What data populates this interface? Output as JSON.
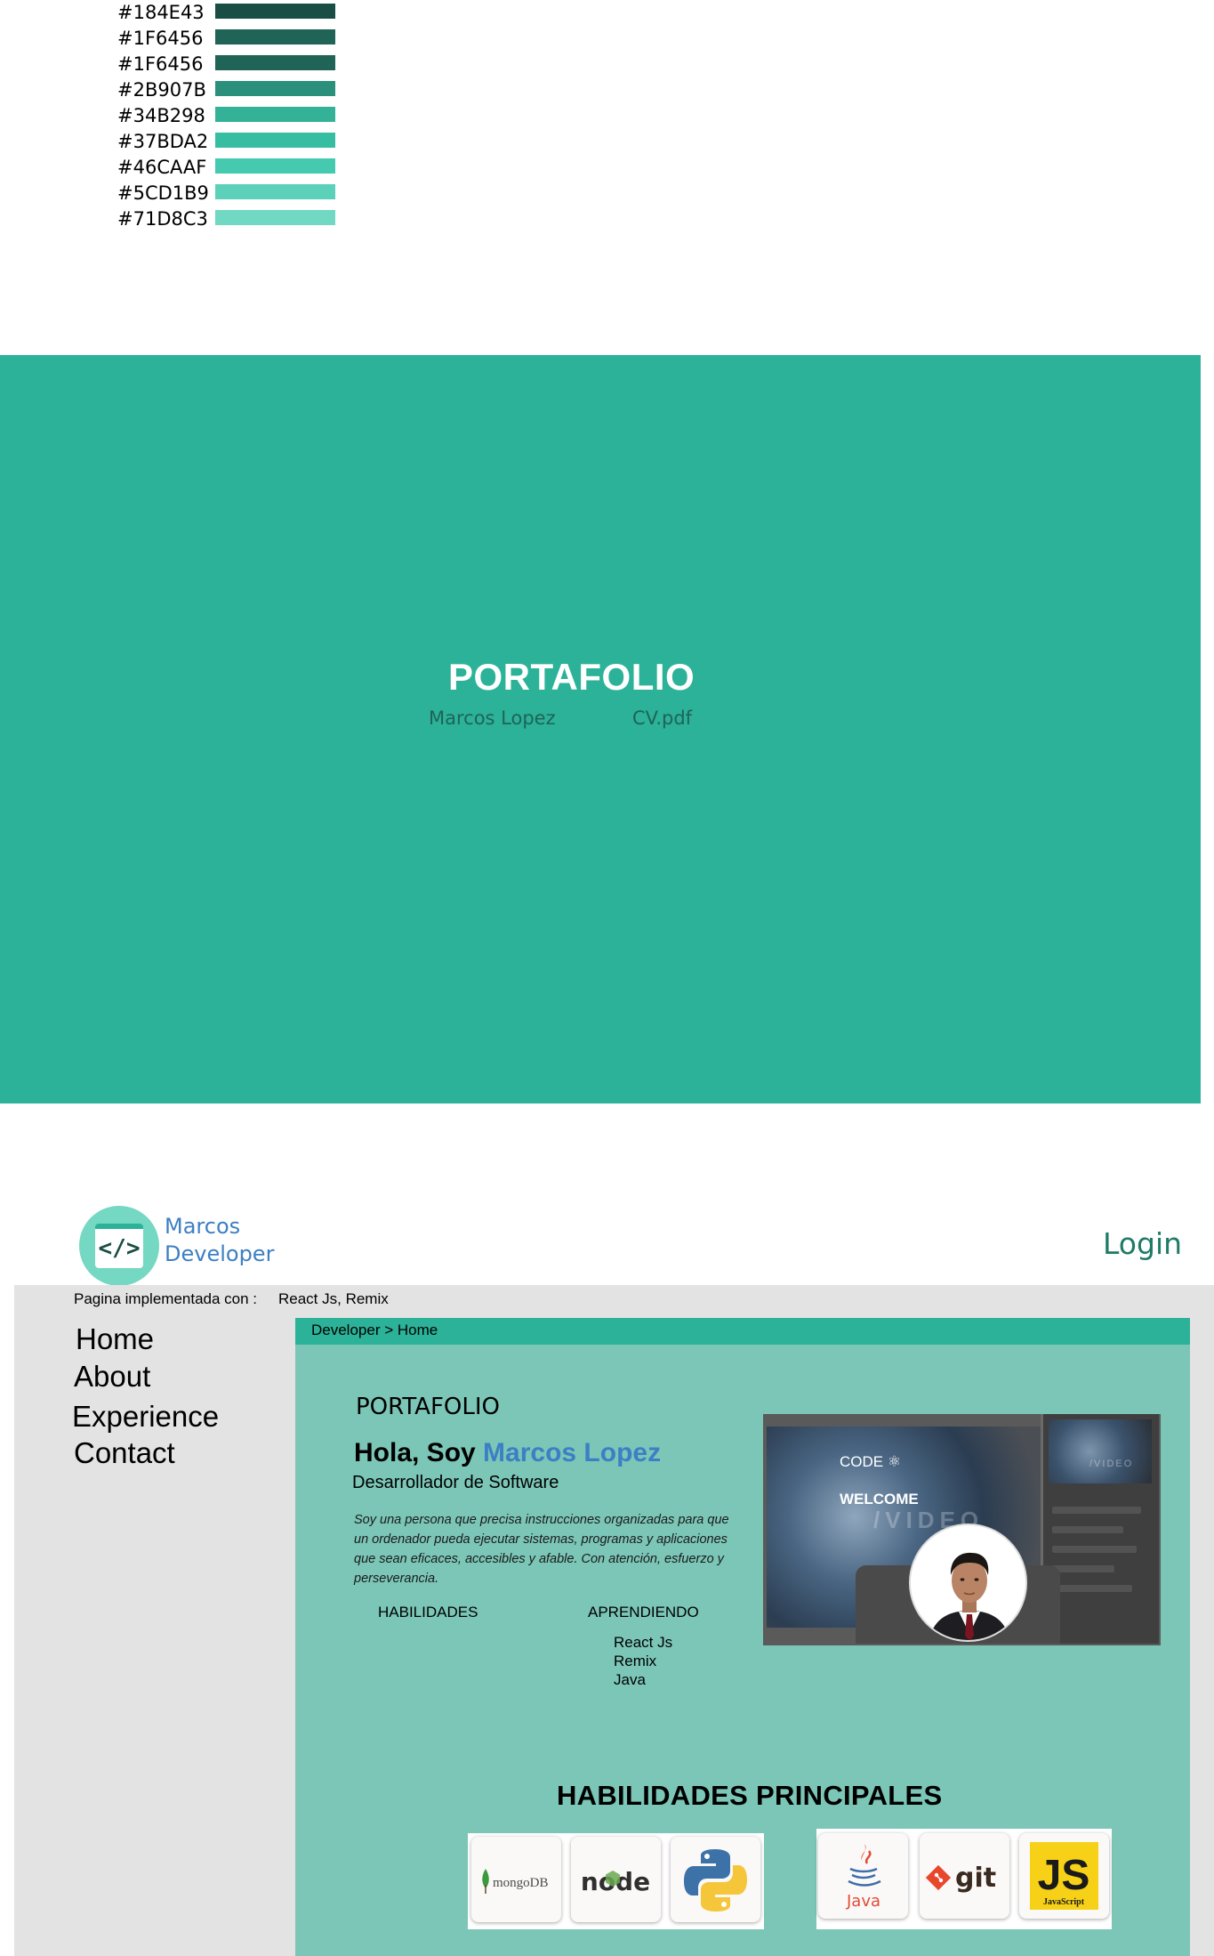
{
  "palette": [
    {
      "label": "#184E43",
      "color": "#184E43"
    },
    {
      "label": "#1F6456",
      "color": "#1F6456"
    },
    {
      "label": "#1F6456",
      "color": "#1F6456"
    },
    {
      "label": "#2B907B",
      "color": "#2B907B"
    },
    {
      "label": "#34B298",
      "color": "#34B298"
    },
    {
      "label": "#37BDA2",
      "color": "#37BDA2"
    },
    {
      "label": "#46CAAF",
      "color": "#46CAAF"
    },
    {
      "label": "#5CD1B9",
      "color": "#5CD1B9"
    },
    {
      "label": "#71D8C3",
      "color": "#71D8C3"
    }
  ],
  "hero": {
    "title": "PORTAFOLIO",
    "name": "Marcos Lopez",
    "cv_link": "CV.pdf",
    "background": "#2BB298"
  },
  "header": {
    "logo_icon": "code-window-icon",
    "brand_line1": "Marcos",
    "brand_line2": "Developer",
    "login": "Login"
  },
  "implementation": {
    "label": "Pagina implementada con :",
    "value": "React Js, Remix"
  },
  "nav": {
    "items": [
      "Home",
      "About",
      "Experience",
      "Contact"
    ]
  },
  "breadcrumb": "Developer > Home",
  "profile": {
    "section_title": "PORTAFOLIO",
    "greeting_prefix": "Hola, Soy ",
    "greeting_name": "Marcos Lopez",
    "role": "Desarrollador de Software",
    "bio": "Soy una persona que precisa instrucciones organizadas para que un ordenador pueda ejecutar sistemas, programas y aplicaciones que sean eficaces, accesibles y afable. Con atención, esfuerzo y perseverancia.",
    "skills_label": "HABILIDADES",
    "learning_label": "APRENDIENDO",
    "learning_items": [
      "React Js",
      "Remix",
      "Java"
    ]
  },
  "hero_image": {
    "code_text": "CODE ⚛",
    "welcome_text": "WELCOME",
    "video_text": "/VIDEO",
    "thumb_text": "/VIDEO"
  },
  "main_skills": {
    "title": "HABILIDADES PRINCIPALES",
    "logos": [
      {
        "name": "mongodb",
        "text": "mongoDB"
      },
      {
        "name": "node",
        "text": "node"
      },
      {
        "name": "python",
        "text": ""
      },
      {
        "name": "java",
        "text": "Java"
      },
      {
        "name": "git",
        "text": "git"
      },
      {
        "name": "javascript",
        "text": "JS",
        "subtext": "JavaScript"
      }
    ]
  },
  "colors": {
    "accent": "#2BB298",
    "content_bg": "#7BC6B7",
    "brand_blue": "#3D7FC4",
    "sidebar_bg": "#E4E3E3"
  }
}
